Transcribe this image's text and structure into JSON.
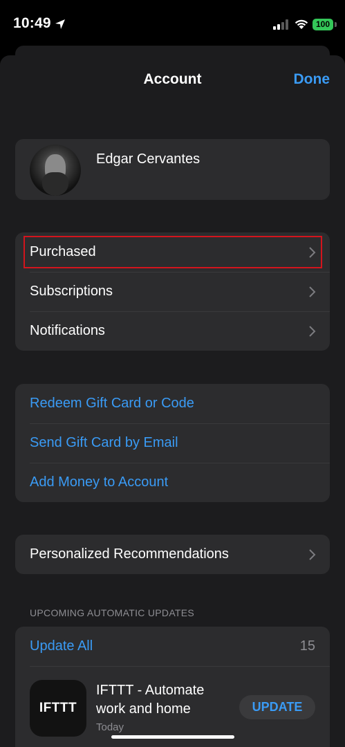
{
  "status_bar": {
    "time": "10:49",
    "battery": "100",
    "icons": [
      "location-arrow-icon",
      "cellular-signal-icon",
      "wifi-icon",
      "battery-icon"
    ]
  },
  "header": {
    "title": "Account",
    "done_label": "Done"
  },
  "profile": {
    "name": "Edgar Cervantes"
  },
  "group_main": {
    "items": [
      {
        "label": "Purchased",
        "highlighted": true
      },
      {
        "label": "Subscriptions"
      },
      {
        "label": "Notifications"
      }
    ]
  },
  "group_gift": {
    "items": [
      {
        "label": "Redeem Gift Card or Code"
      },
      {
        "label": "Send Gift Card by Email"
      },
      {
        "label": "Add Money to Account"
      }
    ]
  },
  "recommendations": {
    "label": "Personalized Recommendations"
  },
  "updates": {
    "section_header": "UPCOMING AUTOMATIC UPDATES",
    "update_all_label": "Update All",
    "count": "15",
    "app": {
      "icon_text": "IFTTT",
      "name": "IFTTT - Automate work and home",
      "date": "Today",
      "button_label": "UPDATE"
    }
  },
  "colors": {
    "accent_blue": "#3a9bf5",
    "highlight_red": "#d3141d",
    "battery_green": "#34c759",
    "sheet_bg": "#1c1c1e",
    "cell_bg": "#2c2c2e"
  }
}
